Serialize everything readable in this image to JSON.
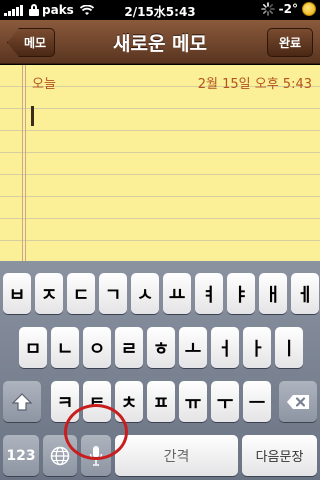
{
  "status_bar": {
    "carrier": "paks",
    "time": "2/15水5:43",
    "temperature": "-2°",
    "icons": [
      "signal-bars-icon",
      "lock-icon",
      "wifi-icon",
      "activity-spinner-icon",
      "weather-sun-icon"
    ]
  },
  "nav": {
    "back_label": "메모",
    "title": "새로운 메모",
    "done_label": "완료"
  },
  "note": {
    "date_label": "오늘",
    "date_value": "2월 15일  오후 5:43",
    "body": ""
  },
  "keyboard": {
    "row1": [
      "ㅂ",
      "ㅈ",
      "ㄷ",
      "ㄱ",
      "ㅅ",
      "ㅛ",
      "ㅕ",
      "ㅑ",
      "ㅐ",
      "ㅔ"
    ],
    "row2": [
      "ㅁ",
      "ㄴ",
      "ㅇ",
      "ㄹ",
      "ㅎ",
      "ㅗ",
      "ㅓ",
      "ㅏ",
      "ㅣ"
    ],
    "row3": [
      "ㅋ",
      "ㅌ",
      "ㅊ",
      "ㅍ",
      "ㅠ",
      "ㅜ",
      "ㅡ"
    ],
    "numbers_label": "123",
    "space_label": "간격",
    "return_label": "다음문장",
    "special_icons": [
      "shift-icon",
      "delete-icon",
      "globe-icon",
      "microphone-icon"
    ]
  },
  "colors": {
    "nav_brown": "#6a4028",
    "paper_yellow": "#fbf098",
    "date_orange": "#b3531f",
    "highlight_circle": "#c81e1e"
  }
}
